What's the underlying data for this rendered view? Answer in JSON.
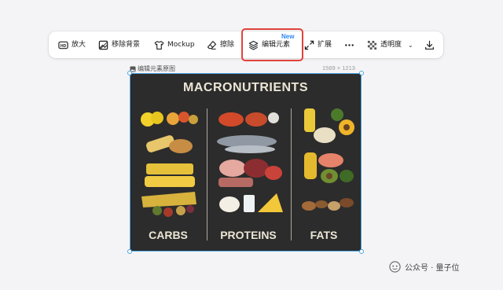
{
  "toolbar": {
    "items": [
      {
        "name": "upscale",
        "label": "放大",
        "icon": "hd-icon"
      },
      {
        "name": "remove-background",
        "label": "移除背景",
        "icon": "image-frame-icon"
      },
      {
        "name": "mockup",
        "label": "Mockup",
        "icon": "tshirt-icon"
      },
      {
        "name": "erase",
        "label": "擦除",
        "icon": "eraser-icon"
      },
      {
        "name": "edit-elements",
        "label": "编辑元素",
        "icon": "layers-icon",
        "badge": "New"
      },
      {
        "name": "expand",
        "label": "扩展",
        "icon": "expand-arrows-icon"
      },
      {
        "name": "more",
        "label": "",
        "icon": "ellipsis-icon"
      },
      {
        "name": "transparency",
        "label": "透明度",
        "icon": "checkerboard-icon"
      },
      {
        "name": "download",
        "label": "",
        "icon": "download-icon"
      }
    ],
    "highlight_color": "#e0433b",
    "badge_color": "#2f86f6"
  },
  "canvas": {
    "label": "编辑元素原图",
    "dimensions": "1569 × 1213"
  },
  "image": {
    "title": "MACRONUTRIENTS",
    "columns": [
      "CARBS",
      "PROTEINS",
      "FATS"
    ]
  },
  "watermark": {
    "text": "公众号 · 量子位"
  },
  "colors": {
    "selection": "#4aa3e0",
    "poster_bg": "#2c2c2c",
    "poster_text": "#ece6d6"
  }
}
